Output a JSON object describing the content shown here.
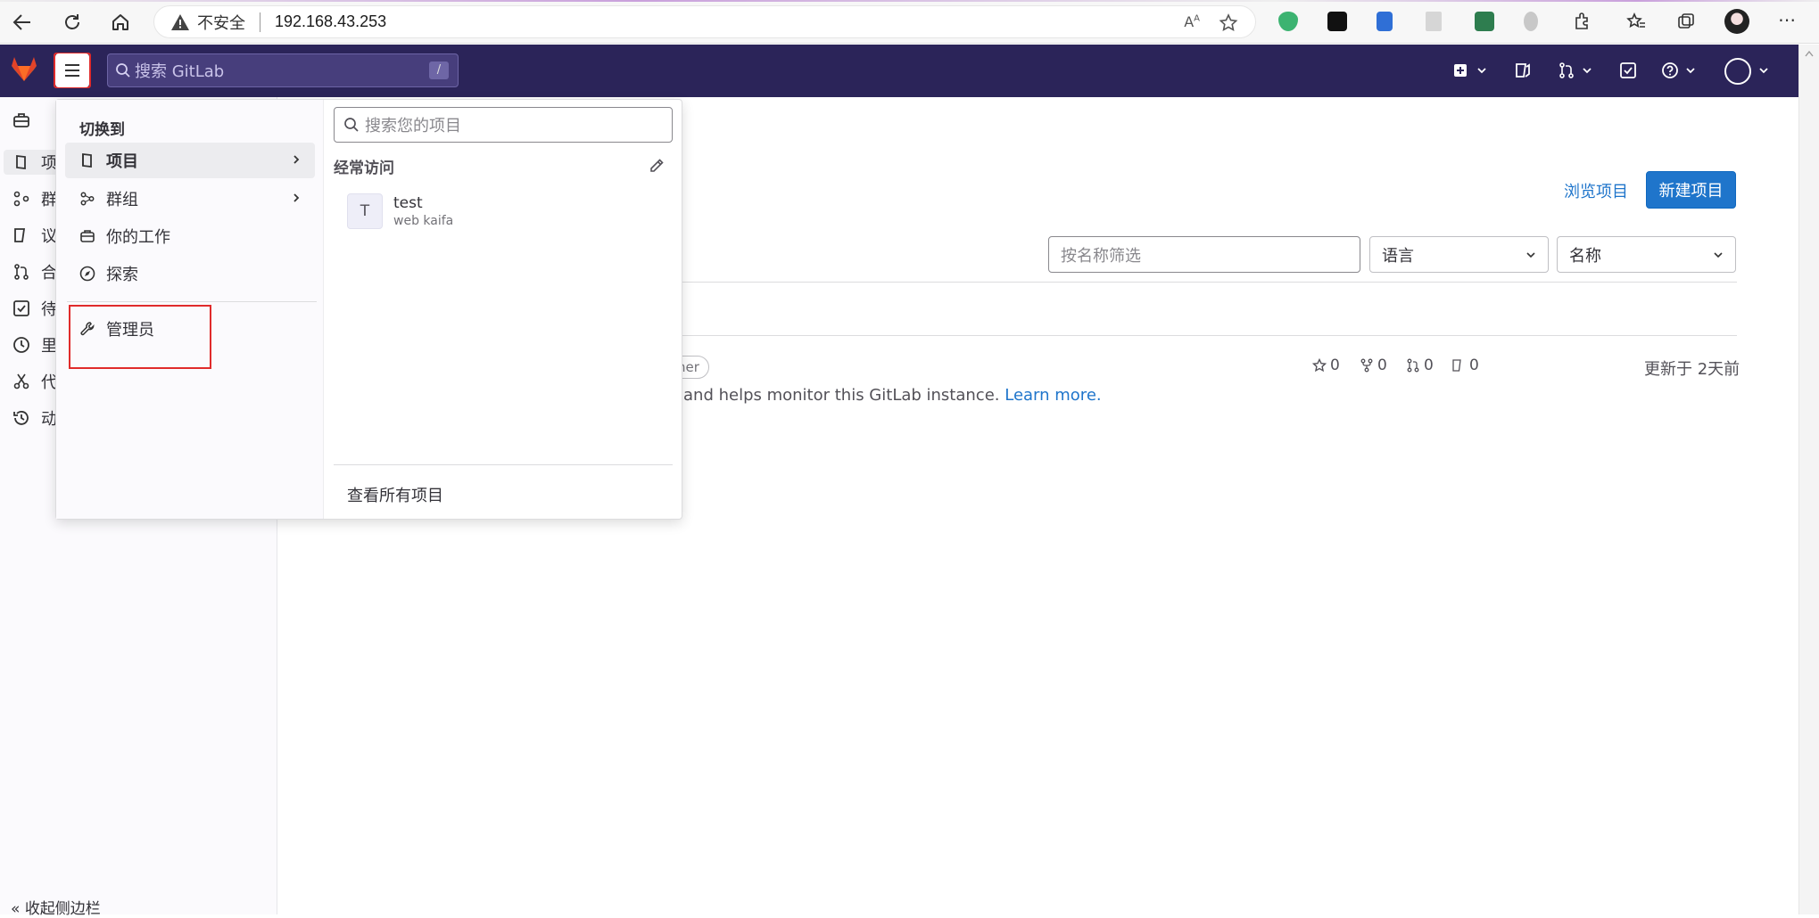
{
  "browser": {
    "insecure_label": "不安全",
    "url": "192.168.43.253",
    "reader_label": "Aᴬ"
  },
  "header": {
    "search_placeholder": "搜索 GitLab",
    "search_shortcut": "/"
  },
  "sidebar": {
    "items": [
      {
        "label": "项",
        "icon": "project-icon"
      },
      {
        "label": "群",
        "icon": "group-icon"
      },
      {
        "label": "议",
        "icon": "issues-icon"
      },
      {
        "label": "合",
        "icon": "merge-request-icon"
      },
      {
        "label": "待",
        "icon": "todo-icon"
      },
      {
        "label": "里",
        "icon": "milestone-icon"
      },
      {
        "label": "代",
        "icon": "snippet-icon"
      },
      {
        "label": "动",
        "icon": "activity-icon"
      }
    ],
    "collapse_label": "收起侧边栏"
  },
  "main": {
    "browse_projects": "浏览项目",
    "new_project": "新建项目",
    "filter_placeholder": "按名称筛选",
    "language_dropdown": "语言",
    "sort_dropdown": "名称",
    "project_row": {
      "badge": "ner",
      "description_text": "and helps monitor this GitLab instance.",
      "learn_more": "Learn more.",
      "stars": "0",
      "forks": "0",
      "merge_requests": "0",
      "issues": "0",
      "updated": "更新于 2天前"
    }
  },
  "menu": {
    "switch_to": "切换到",
    "items": [
      {
        "label": "项目",
        "icon": "project-icon",
        "active": true,
        "has_submenu": true
      },
      {
        "label": "群组",
        "icon": "group-icon",
        "active": false,
        "has_submenu": true
      },
      {
        "label": "你的工作",
        "icon": "briefcase-icon",
        "active": false,
        "has_submenu": false
      },
      {
        "label": "探索",
        "icon": "compass-icon",
        "active": false,
        "has_submenu": false
      }
    ],
    "admin_label": "管理员",
    "project_search_placeholder": "搜索您的项目",
    "frequent_title": "经常访问",
    "frequent_projects": [
      {
        "avatar_letter": "T",
        "name": "test",
        "namespace": "web kaifa"
      }
    ],
    "view_all": "查看所有项目"
  },
  "colors": {
    "header_bg": "#2b2459",
    "primary": "#1f75cb",
    "highlight_border": "#e02b2b"
  }
}
